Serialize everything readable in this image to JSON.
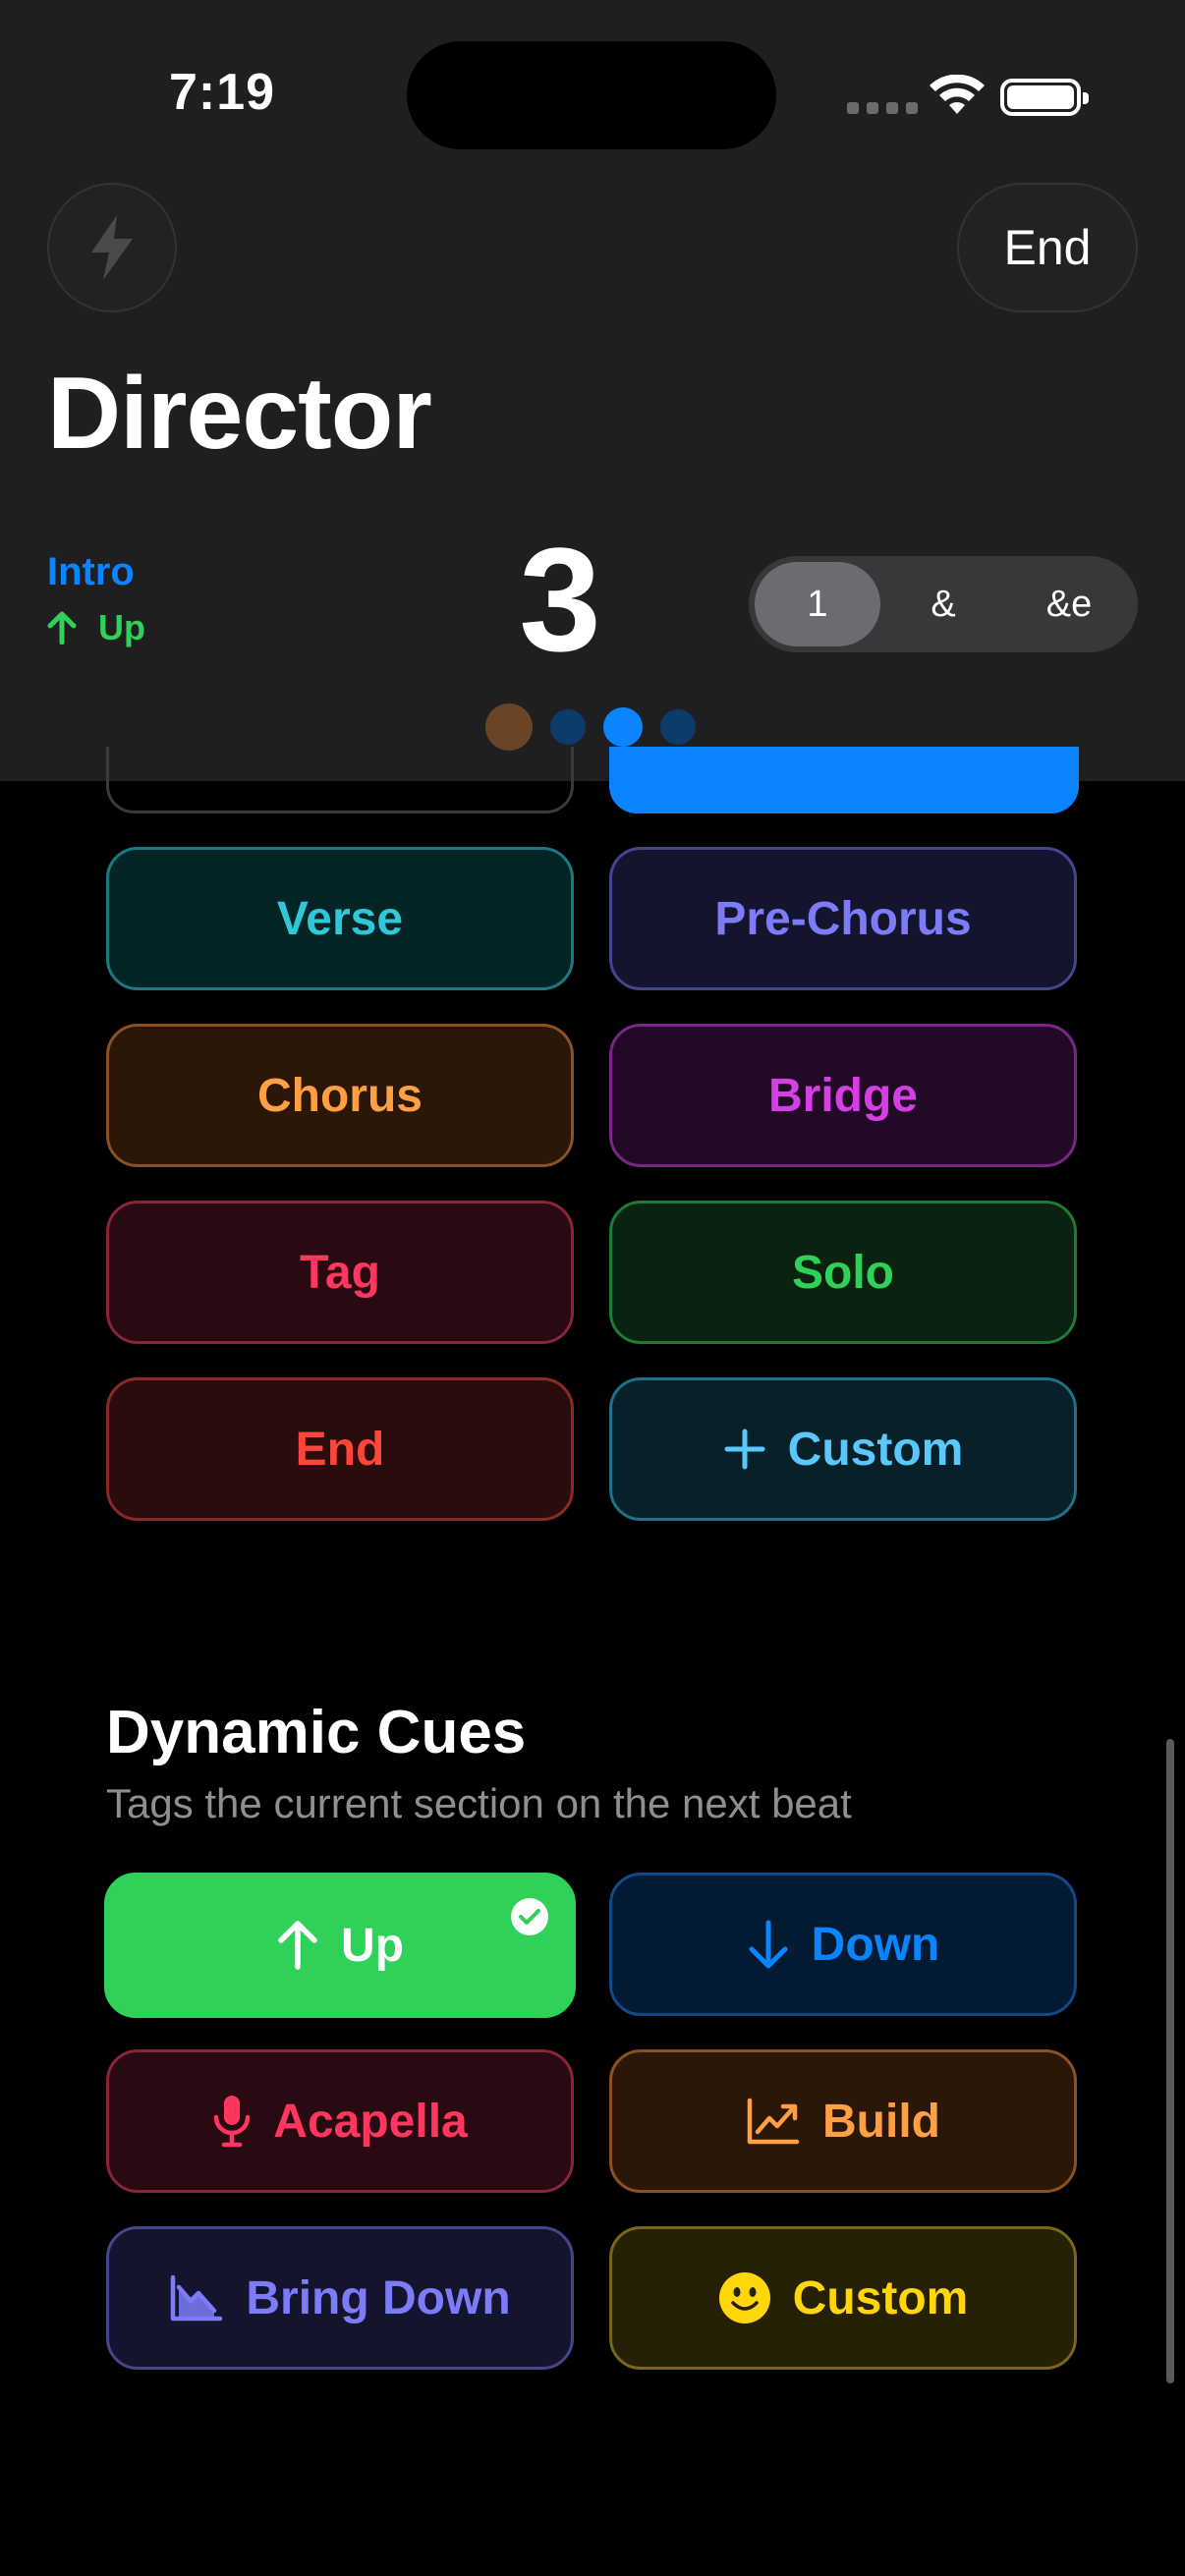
{
  "status": {
    "time": "7:19"
  },
  "header": {
    "end_label": "End",
    "title": "Director",
    "current_section": "Intro",
    "current_dynamic": "Up",
    "beat": "3",
    "subdivisions": [
      "1",
      "&",
      "&e"
    ],
    "selected_subdivision": "1"
  },
  "sections": [
    {
      "label": "Verse",
      "color": "#30c8d8",
      "bg": "#042426",
      "border": "#1a7a80"
    },
    {
      "label": "Pre-Chorus",
      "color": "#7c7cf8",
      "bg": "#14142e",
      "border": "#45458e"
    },
    {
      "label": "Chorus",
      "color": "#ff9f43",
      "bg": "#2a1708",
      "border": "#8a5124"
    },
    {
      "label": "Bridge",
      "color": "#d63ee6",
      "bg": "#220a26",
      "border": "#7a2686"
    },
    {
      "label": "Tag",
      "color": "#ff375f",
      "bg": "#2a0a12",
      "border": "#8a2438"
    },
    {
      "label": "Solo",
      "color": "#30d158",
      "bg": "#0a2210",
      "border": "#1f7a34"
    },
    {
      "label": "End",
      "color": "#ff453a",
      "bg": "#2a0c0c",
      "border": "#8a2a26"
    },
    {
      "label": "Custom",
      "color": "#5ac8fa",
      "bg": "#082028",
      "border": "#20708a",
      "icon": "plus-icon"
    }
  ],
  "dynamic_cues": {
    "title": "Dynamic Cues",
    "subtitle": "Tags the current section on the next beat",
    "items": [
      {
        "label": "Up",
        "icon": "arrow-up-icon",
        "color": "#ffffff",
        "bg": "#30d158",
        "border": "#30d158",
        "selected": true
      },
      {
        "label": "Down",
        "icon": "arrow-down-icon",
        "color": "#0a84ff",
        "bg": "#031a33",
        "border": "#104a8a"
      },
      {
        "label": "Acapella",
        "icon": "microphone-icon",
        "color": "#ff375f",
        "bg": "#2a0a12",
        "border": "#8a2438"
      },
      {
        "label": "Build",
        "icon": "chart-up-icon",
        "color": "#ff9f43",
        "bg": "#2a1708",
        "border": "#8a5124"
      },
      {
        "label": "Bring Down",
        "icon": "chart-down-icon",
        "color": "#7c7cf8",
        "bg": "#14142e",
        "border": "#45458e"
      },
      {
        "label": "Custom",
        "icon": "smiley-icon",
        "color": "#ffd60a",
        "bg": "#262006",
        "border": "#7a6618"
      }
    ]
  }
}
